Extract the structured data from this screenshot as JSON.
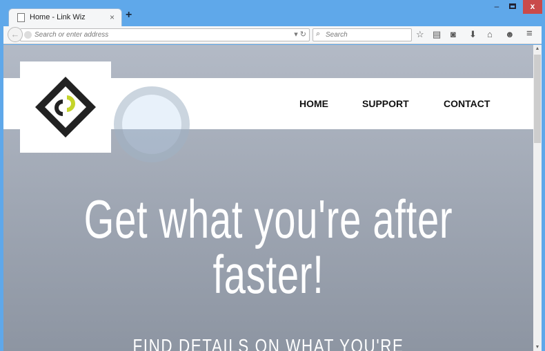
{
  "browser": {
    "tab_title": "Home - Link Wiz",
    "address_placeholder": "Search or enter address",
    "search_placeholder": "Search",
    "window_controls": {
      "minimize": "–",
      "close": "x"
    }
  },
  "site": {
    "nav": [
      "HOME",
      "SUPPORT",
      "CONTACT"
    ],
    "headline_line1": "Get what you're after",
    "headline_line2": "faster!",
    "subheading": "FIND DETAILS ON WHAT YOU'RE"
  },
  "colors": {
    "titlebar": "#5fa8ea",
    "logo_accent": "#c5d42a"
  }
}
